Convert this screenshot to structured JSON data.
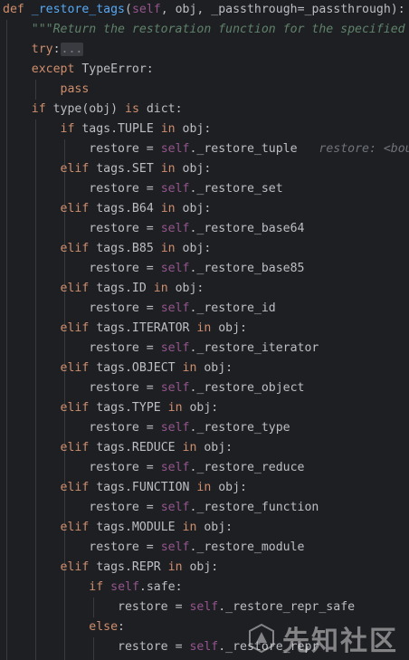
{
  "code": {
    "line_def": {
      "kw_def": "def",
      "fn_name": "_restore_tags",
      "open_paren": "(",
      "self_kw": "self",
      "params": ", obj, _passthrough=_passthrough):"
    },
    "line_doc": "\"\"\"Return the restoration function for the specified",
    "line_try": {
      "kw": "try",
      "colon": ":",
      "fold": "..."
    },
    "line_except": {
      "kw": "except",
      "exc": " TypeError:"
    },
    "line_pass": "pass",
    "line_if_type": {
      "kw_if": "if",
      "mid": " type(obj) ",
      "kw_is": "is",
      "tail": " dict:"
    },
    "branches": [
      {
        "cond_kw": "if",
        "tag": " tags.TUPLE ",
        "in_kw": "in",
        "obj": " obj:",
        "target": "restore = ",
        "self_kw": "self",
        "method": "._restore_tuple",
        "hint": "restore: <bou"
      },
      {
        "cond_kw": "elif",
        "tag": " tags.SET ",
        "in_kw": "in",
        "obj": " obj:",
        "target": "restore = ",
        "self_kw": "self",
        "method": "._restore_set"
      },
      {
        "cond_kw": "elif",
        "tag": " tags.B64 ",
        "in_kw": "in",
        "obj": " obj:",
        "target": "restore = ",
        "self_kw": "self",
        "method": "._restore_base64"
      },
      {
        "cond_kw": "elif",
        "tag": " tags.B85 ",
        "in_kw": "in",
        "obj": " obj:",
        "target": "restore = ",
        "self_kw": "self",
        "method": "._restore_base85"
      },
      {
        "cond_kw": "elif",
        "tag": " tags.ID ",
        "in_kw": "in",
        "obj": " obj:",
        "target": "restore = ",
        "self_kw": "self",
        "method": "._restore_id"
      },
      {
        "cond_kw": "elif",
        "tag": " tags.ITERATOR ",
        "in_kw": "in",
        "obj": " obj:",
        "target": "restore = ",
        "self_kw": "self",
        "method": "._restore_iterator"
      },
      {
        "cond_kw": "elif",
        "tag": " tags.OBJECT ",
        "in_kw": "in",
        "obj": " obj:",
        "target": "restore = ",
        "self_kw": "self",
        "method": "._restore_object"
      },
      {
        "cond_kw": "elif",
        "tag": " tags.TYPE ",
        "in_kw": "in",
        "obj": " obj:",
        "target": "restore = ",
        "self_kw": "self",
        "method": "._restore_type"
      },
      {
        "cond_kw": "elif",
        "tag": " tags.REDUCE ",
        "in_kw": "in",
        "obj": " obj:",
        "target": "restore = ",
        "self_kw": "self",
        "method": "._restore_reduce"
      },
      {
        "cond_kw": "elif",
        "tag": " tags.FUNCTION ",
        "in_kw": "in",
        "obj": " obj:",
        "target": "restore = ",
        "self_kw": "self",
        "method": "._restore_function"
      },
      {
        "cond_kw": "elif",
        "tag": " tags.MODULE ",
        "in_kw": "in",
        "obj": " obj:",
        "target": "restore = ",
        "self_kw": "self",
        "method": "._restore_module"
      }
    ],
    "repr_branch": {
      "cond_kw": "elif",
      "tag": " tags.REPR ",
      "in_kw": "in",
      "obj": " obj:",
      "if_kw": "if",
      "safe_self": "self",
      "safe_attr": ".safe:",
      "safe_target": "restore = ",
      "safe_self2": "self",
      "safe_method": "._restore_repr_safe",
      "else_kw": "else",
      "else_colon": ":",
      "else_target": "restore = ",
      "else_self": "self",
      "else_method": "._restore_repr"
    }
  },
  "watermark": {
    "text": "先知社区"
  },
  "colors": {
    "background": "#1e1f22",
    "keyword": "#cf8e6d",
    "function": "#56a8f5",
    "self": "#94558d",
    "docstring": "#5f826b",
    "text": "#bcbec4",
    "inlay_hint": "#6f737a"
  }
}
